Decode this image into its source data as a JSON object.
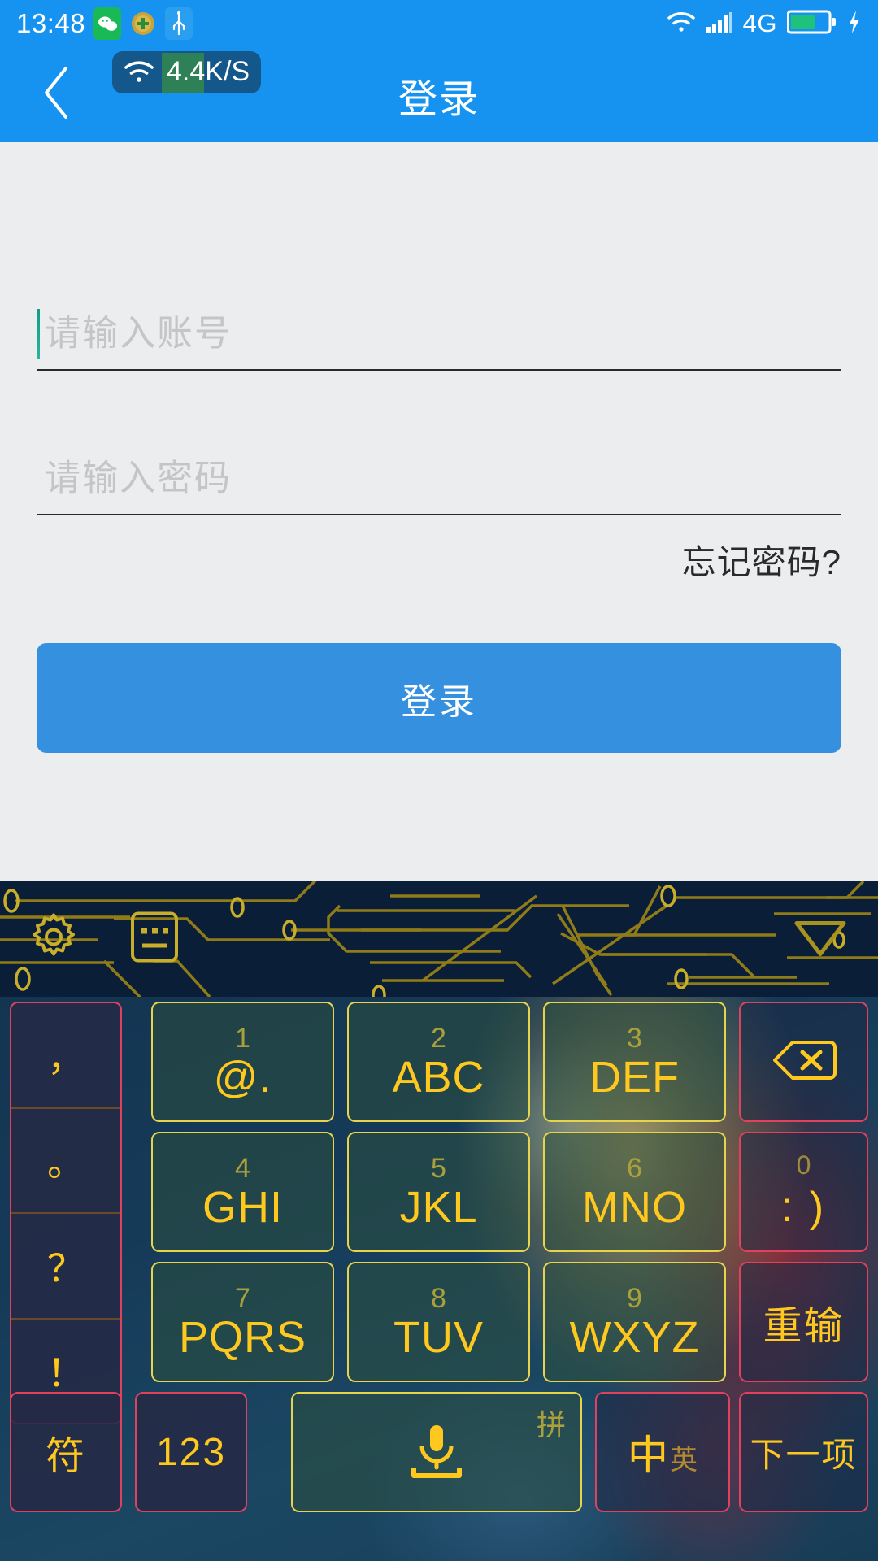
{
  "status_bar": {
    "time": "13:48",
    "left_icons": [
      "wechat-icon",
      "security-shield-icon",
      "usb-icon"
    ],
    "network_type": "4G",
    "right_icons": [
      "wifi-icon",
      "signal-bars-icon",
      "battery-icon",
      "charging-bolt-icon"
    ]
  },
  "net_speed_overlay": {
    "icon": "wifi-icon",
    "value": "4.4K/S"
  },
  "app_bar": {
    "back_icon": "chevron-left-icon",
    "title": "登录"
  },
  "form": {
    "account": {
      "value": "",
      "placeholder": "请输入账号"
    },
    "password": {
      "value": "",
      "placeholder": "请输入密码"
    },
    "forgot_password_label": "忘记密码?",
    "login_button_label": "登录"
  },
  "keyboard": {
    "toolbar": {
      "settings_icon": "gear-icon",
      "emoji_icon": "emoji-face-icon",
      "collapse_icon": "triangle-down-icon"
    },
    "punctuation_key": {
      "items": [
        "，",
        "。",
        "？",
        "！"
      ]
    },
    "number_keys": [
      {
        "digit": "1",
        "letters": "@."
      },
      {
        "digit": "2",
        "letters": "ABC"
      },
      {
        "digit": "3",
        "letters": "DEF"
      },
      {
        "digit": "4",
        "letters": "GHI"
      },
      {
        "digit": "5",
        "letters": "JKL"
      },
      {
        "digit": "6",
        "letters": "MNO"
      },
      {
        "digit": "7",
        "letters": "PQRS"
      },
      {
        "digit": "8",
        "letters": "TUV"
      },
      {
        "digit": "9",
        "letters": "WXYZ"
      }
    ],
    "right_keys": {
      "backspace_icon": "backspace-icon",
      "zero_digit": "0",
      "zero_label": ": )",
      "reenter_label": "重输"
    },
    "bottom_row": {
      "symbols_label": "符",
      "numbers_label": "123",
      "space_pinyin_label": "拼",
      "space_icon": "microphone-icon",
      "lang_toggle_primary": "中",
      "lang_toggle_secondary": "英",
      "next_field_label": "下一项"
    }
  },
  "colors": {
    "app_bar_blue": "#1693F0",
    "page_background": "#ECEDEE",
    "login_button_blue": "#3591DF",
    "placeholder_gray": "#C3C5C7",
    "caret_teal": "#0E9E85",
    "key_yellow": "#FFC81E",
    "key_border_yellow": "#E8D44A",
    "key_border_red": "#E0415F",
    "keyboard_navy": "#122F4D",
    "toolbar_navy": "#0A1E38",
    "circuit_gold": "#A8931E"
  }
}
